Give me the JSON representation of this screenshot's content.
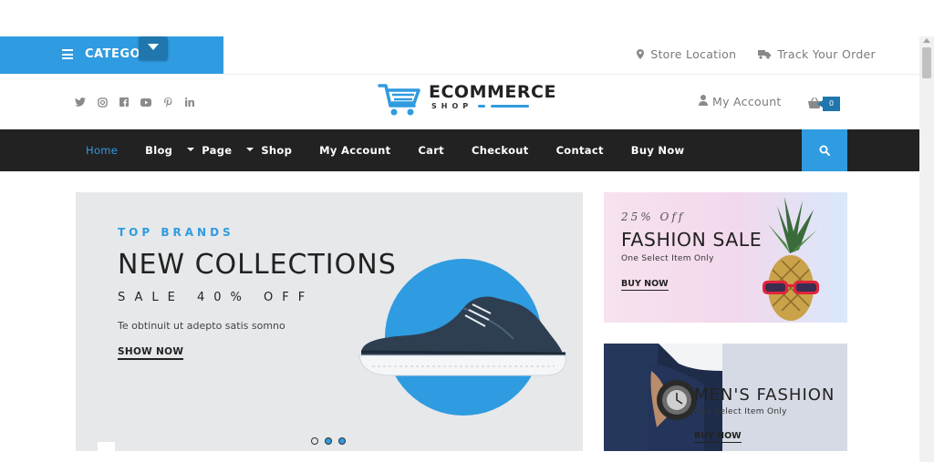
{
  "category": {
    "label": "CATEGOR"
  },
  "top_links": {
    "store_location": "Store Location",
    "track_order": "Track Your Order"
  },
  "socials": [
    "twitter-icon",
    "instagram-icon",
    "facebook-icon",
    "youtube-icon",
    "pinterest-icon",
    "linkedin-icon"
  ],
  "logo": {
    "title": "ECOMMERCE",
    "subtitle": "SHOP"
  },
  "header": {
    "account_label": "My Account",
    "cart_count": "0"
  },
  "nav": {
    "items": [
      {
        "label": "Home",
        "active": true
      },
      {
        "label": "Blog",
        "dropdown": true
      },
      {
        "label": "Page",
        "dropdown": true
      },
      {
        "label": "Shop"
      },
      {
        "label": "My Account"
      },
      {
        "label": "Cart"
      },
      {
        "label": "Checkout"
      },
      {
        "label": "Contact"
      },
      {
        "label": "Buy Now"
      }
    ]
  },
  "hero": {
    "tag": "TOP BRANDS",
    "title": "NEW COLLECTIONS",
    "sale": "SALE 40% OFF",
    "description": "Te obtinuit ut adepto satis somno",
    "cta": "SHOW NOW",
    "slides": 3,
    "active_slide": 3
  },
  "banner1": {
    "off": "25% Off",
    "title": "FASHION SALE",
    "subtitle": "One Select Item Only",
    "cta": "BUY NOW"
  },
  "banner2": {
    "title": "MEN'S FASHION",
    "subtitle": "One Select Item Only",
    "cta": "BUY NOW"
  },
  "colors": {
    "accent": "#2f9be0",
    "accent_dark": "#1f77ae",
    "nav_bg": "#222222"
  }
}
